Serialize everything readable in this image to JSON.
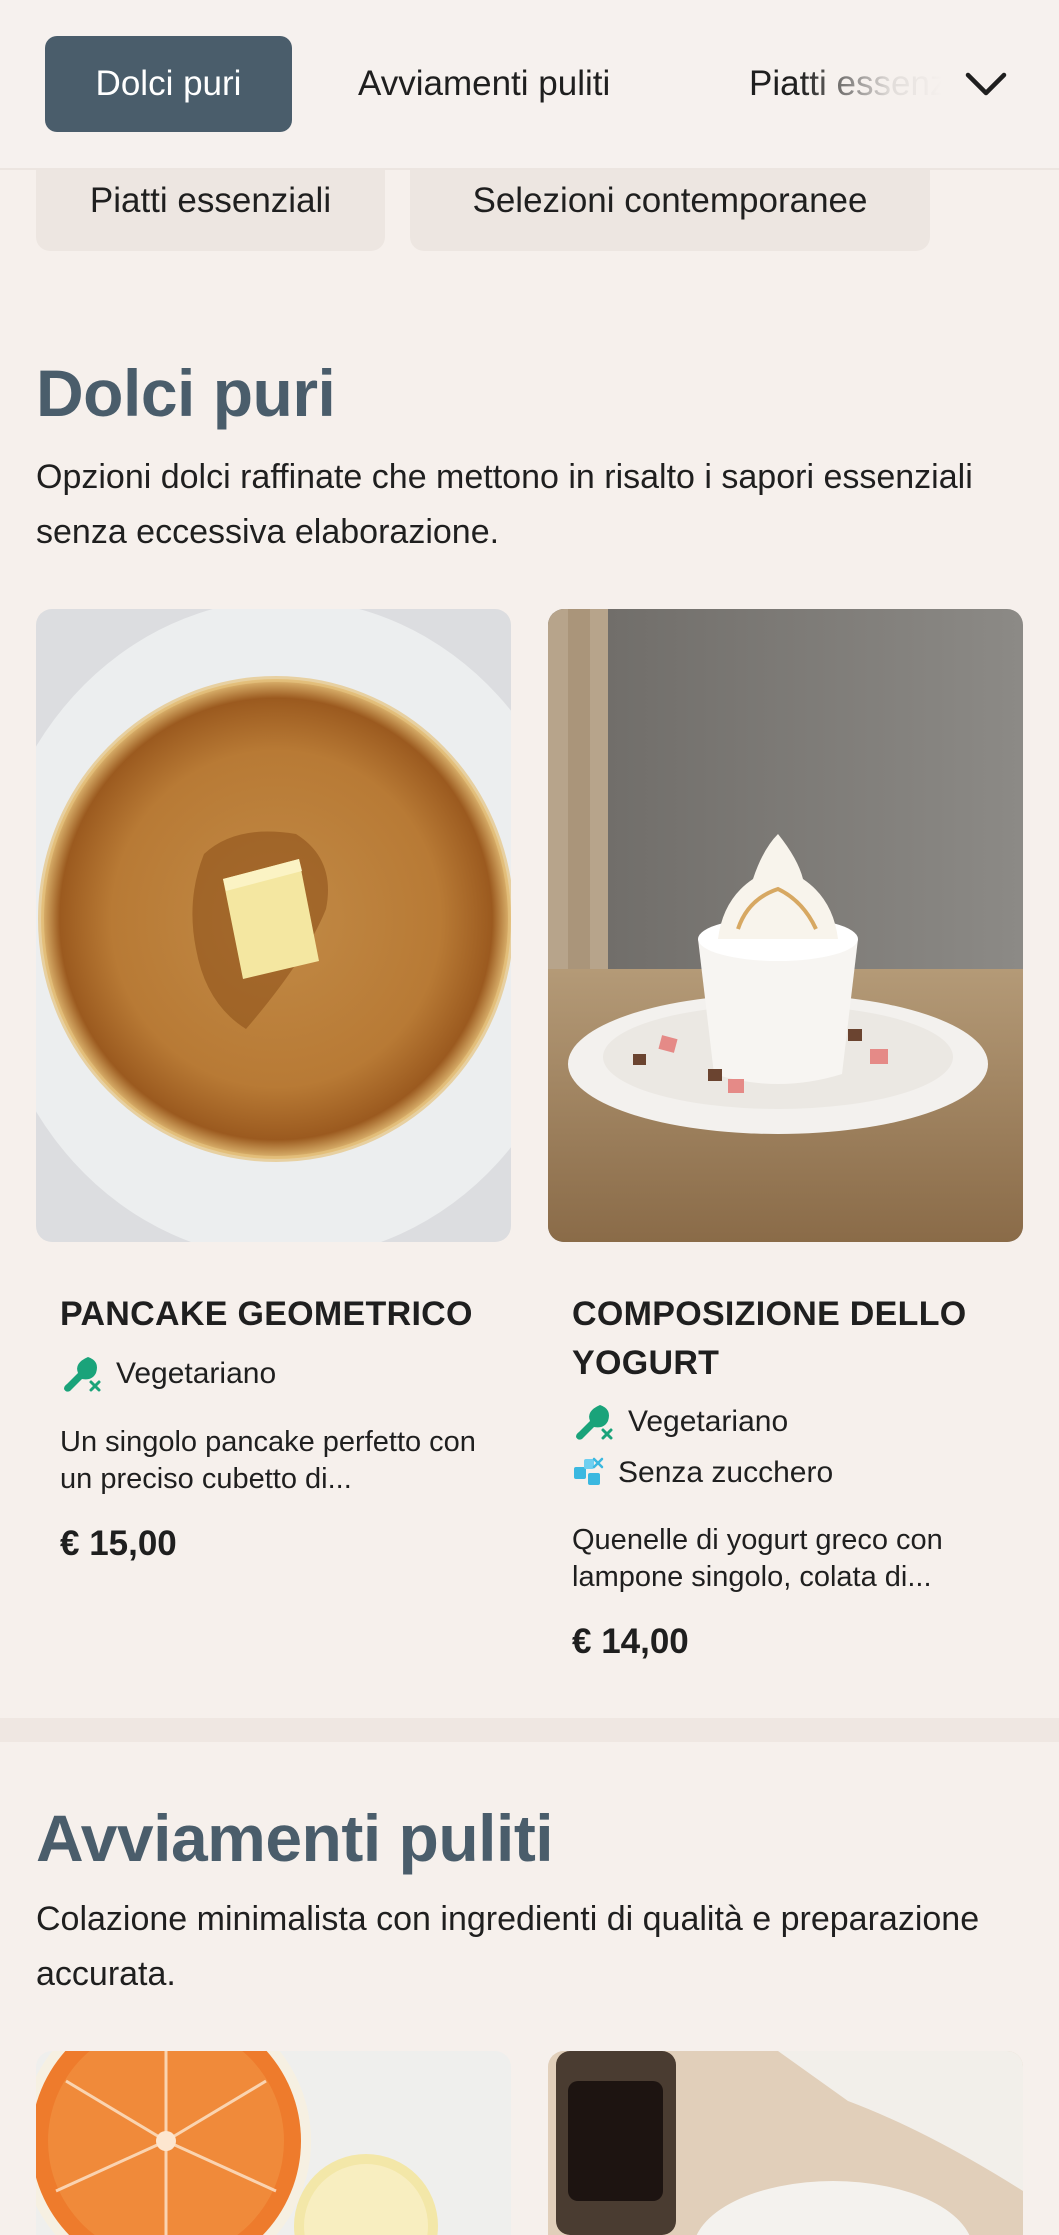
{
  "nav": {
    "tabs": [
      {
        "label": "Dolci puri",
        "active": true
      },
      {
        "label": "Avviamenti puliti",
        "active": false
      },
      {
        "label": "Piatti essenziali",
        "active": false
      }
    ],
    "overflow_chips": [
      "Piatti essenziali",
      "Selezioni contemporanee"
    ],
    "expand_icon": "chevron-down-icon"
  },
  "sections": [
    {
      "title": "Dolci puri",
      "description": "Opzioni dolci raffinate che mettono in risalto i sapori essenziali senza eccessiva elaborazione.",
      "products": [
        {
          "name": "PANCAKE GEOMETRICO",
          "tags": [
            {
              "label": "Vegetariano",
              "icon": "no-meat-icon"
            }
          ],
          "description": "Un singolo pancake perfetto con un preciso cubetto di...",
          "price": "€ 15,00",
          "image": "pancake-photo"
        },
        {
          "name": "COMPOSIZIONE DELLO YOGURT",
          "tags": [
            {
              "label": "Vegetariano",
              "icon": "no-meat-icon"
            },
            {
              "label": "Senza zucchero",
              "icon": "no-sugar-icon"
            }
          ],
          "description": "Quenelle di yogurt greco con lampone singolo, colata di...",
          "price": "€ 14,00",
          "image": "yogurt-photo"
        }
      ]
    },
    {
      "title": "Avviamenti puliti",
      "description": "Colazione minimalista con ingredienti di qualità e preparazione accurata.",
      "products": [
        {
          "image": "citrus-photo"
        },
        {
          "image": "coffee-photo"
        }
      ]
    }
  ],
  "colors": {
    "background": "#f6f0ec",
    "accent": "#4a5d6b",
    "chip": "#ede6e1",
    "veg_icon": "#1aa37a",
    "sugar_icon": "#3bb8e0"
  }
}
